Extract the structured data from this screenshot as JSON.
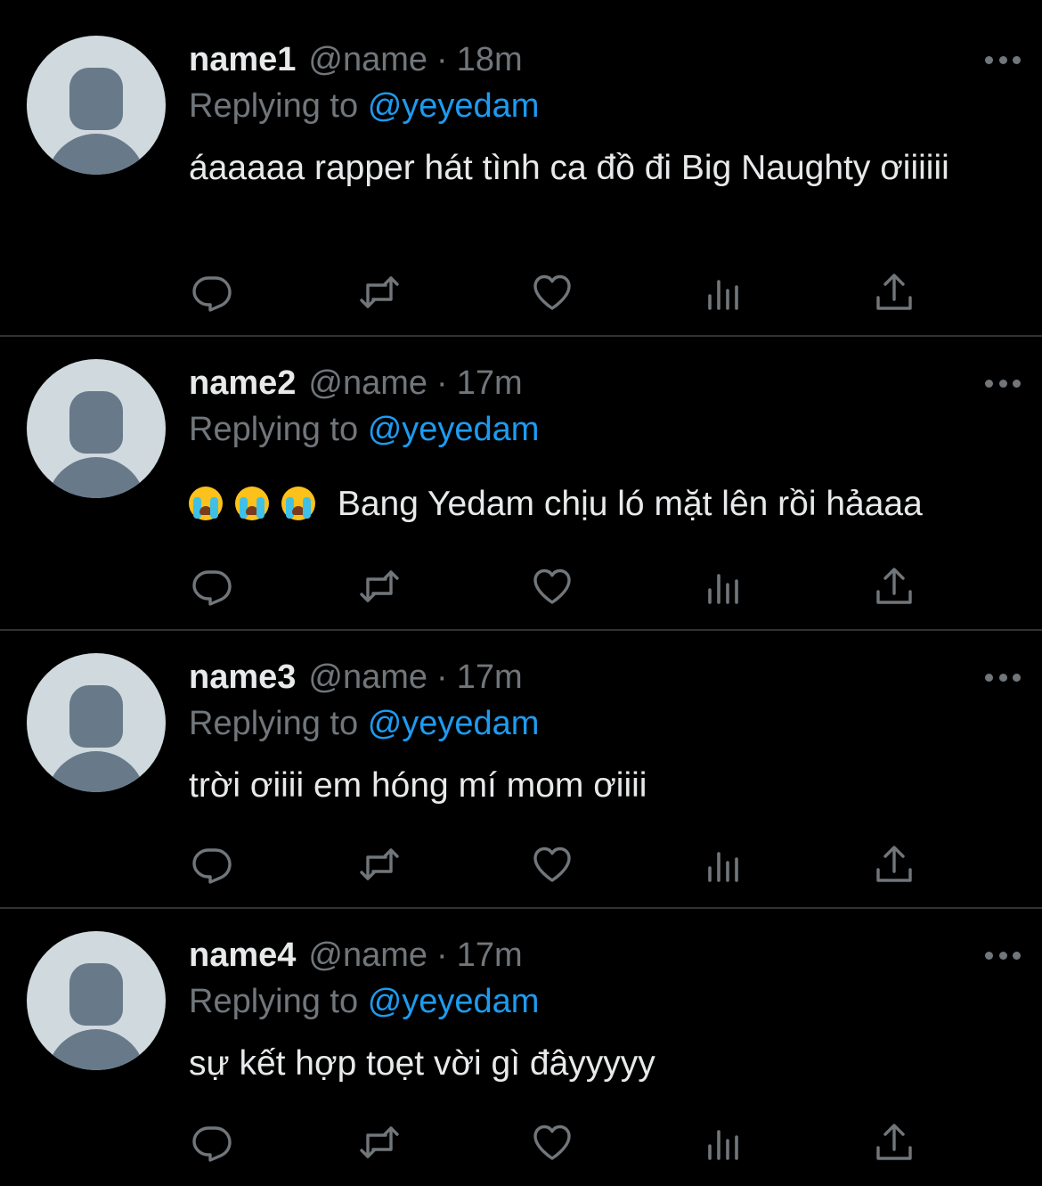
{
  "tweets": [
    {
      "name": "name1",
      "handle": "@name",
      "separator": "·",
      "time": "18m",
      "replying_prefix": "Replying to",
      "mention": "@yeyedam",
      "text": "áaaaaa rapper hát tình ca đồ đi Big Naughty ơiiiiii"
    },
    {
      "name": "name2",
      "handle": "@name",
      "separator": "·",
      "time": "17m",
      "replying_prefix": "Replying to",
      "mention": "@yeyedam",
      "emojis": [
        "loudly-crying-face",
        "loudly-crying-face",
        "loudly-crying-face"
      ],
      "text": "Bang Yedam chịu ló mặt lên rồi hảaaa"
    },
    {
      "name": "name3",
      "handle": "@name",
      "separator": "·",
      "time": "17m",
      "replying_prefix": "Replying to",
      "mention": "@yeyedam",
      "text": "trời ơiiii em hóng mí mom ơiiii"
    },
    {
      "name": "name4",
      "handle": "@name",
      "separator": "·",
      "time": "17m",
      "replying_prefix": "Replying to",
      "mention": "@yeyedam",
      "text": "sự kết hợp toẹt vời gì đâyyyyy"
    }
  ],
  "icons": {
    "reply": "reply-icon",
    "retweet": "retweet-icon",
    "like": "heart-icon",
    "views": "views-icon",
    "share": "share-icon",
    "more": "more-icon"
  },
  "colors": {
    "background": "#000000",
    "text": "#e7e9ea",
    "muted": "#71767b",
    "link": "#1d9bf0",
    "divider": "#2f3336",
    "avatar_bg": "#cfd9de",
    "avatar_fg": "#68798a"
  }
}
